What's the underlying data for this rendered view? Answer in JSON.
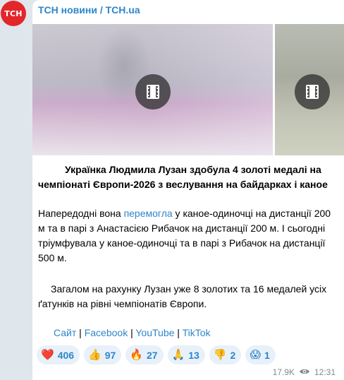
{
  "channel": {
    "avatar_text": "ТСН",
    "avatar_color": "#e3262a",
    "name": "ТСН новини / TCH.ua"
  },
  "media": [
    {
      "type": "video",
      "icon": "film-icon"
    },
    {
      "type": "video",
      "icon": "film-icon"
    }
  ],
  "post": {
    "headline": "Українка Людмила Лузан здобула 4 золоті медалі на чемпіонаті Європи-2026 з веслування на байдарках і каное",
    "p1_before": "Напередодні вона ",
    "p1_link": "перемогла",
    "p1_after": " у каное-одиночці на дистанції 200 м та в парі з Анастасією Рибачок на дистанції 200 м. І сьогодні тріумфувала у каное-одиночці та в парі з Рибачок на дистанції 500 м.",
    "p2": "Загалом на рахунку Лузан уже 8 золотих та 16 медалей усіх ґатунків на рівні чемпіонатів Європи."
  },
  "links": {
    "site": "Сайт",
    "sep": " | ",
    "facebook": "Facebook",
    "youtube": "YouTube",
    "tiktok": "TikTok"
  },
  "reactions": [
    {
      "emoji": "❤️",
      "icon": "heart-icon",
      "count": "406"
    },
    {
      "emoji": "👍",
      "icon": "thumbs-up-icon",
      "count": "97"
    },
    {
      "emoji": "🔥",
      "icon": "fire-icon",
      "count": "27"
    },
    {
      "emoji": "🙏",
      "icon": "pray-icon",
      "count": "13"
    },
    {
      "emoji": "👎",
      "icon": "thumbs-down-icon",
      "count": "2"
    },
    {
      "emoji": "😱",
      "icon": "scream-icon",
      "count": "1"
    }
  ],
  "meta": {
    "views": "17.9K",
    "time": "12:31"
  },
  "colors": {
    "accent": "#2e86c9",
    "background": "#dfe6ec",
    "reaction_bg": "#e8f1fa"
  }
}
